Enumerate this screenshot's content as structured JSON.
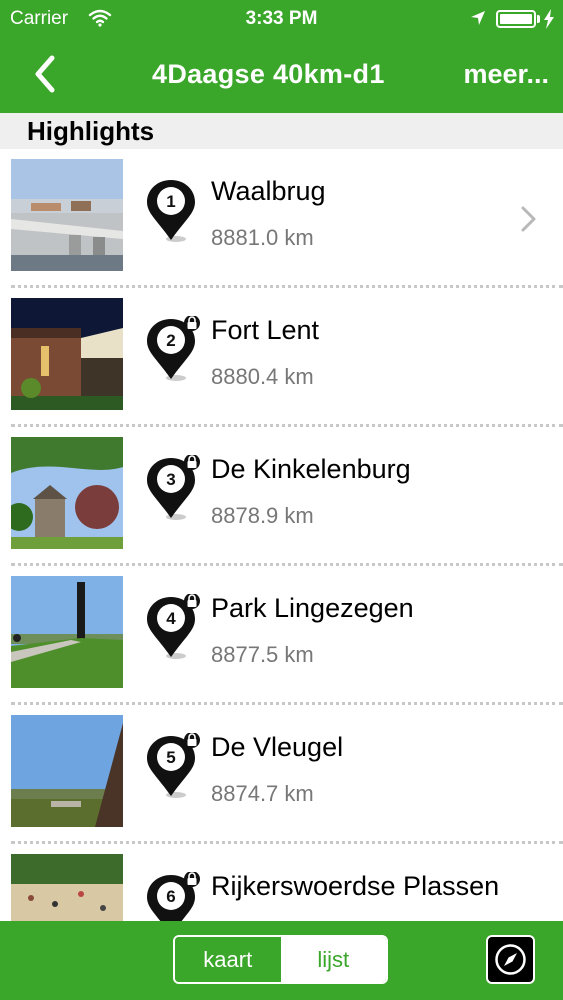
{
  "status_bar": {
    "carrier": "Carrier",
    "time": "3:33 PM",
    "battery_level": 1.0
  },
  "nav": {
    "title": "4Daagse 40km-d1",
    "more_label": "meer..."
  },
  "section": {
    "title": "Highlights"
  },
  "highlights": [
    {
      "number": "1",
      "name": "Waalbrug",
      "distance": "8881.0 km",
      "locked": false
    },
    {
      "number": "2",
      "name": "Fort Lent",
      "distance": "8880.4 km",
      "locked": true
    },
    {
      "number": "3",
      "name": "De Kinkelenburg",
      "distance": "8878.9 km",
      "locked": true
    },
    {
      "number": "4",
      "name": "Park Lingezegen",
      "distance": "8877.5 km",
      "locked": true
    },
    {
      "number": "5",
      "name": "De Vleugel",
      "distance": "8874.7 km",
      "locked": true
    },
    {
      "number": "6",
      "name": "Rijkerswoerdse Plassen",
      "distance": "",
      "locked": true
    }
  ],
  "footer": {
    "kaart_label": "kaart",
    "lijst_label": "lijst",
    "selected": "lijst"
  },
  "colors": {
    "brand_green": "#3aa62a",
    "section_bg": "#efefef",
    "distance_text": "#777777"
  }
}
